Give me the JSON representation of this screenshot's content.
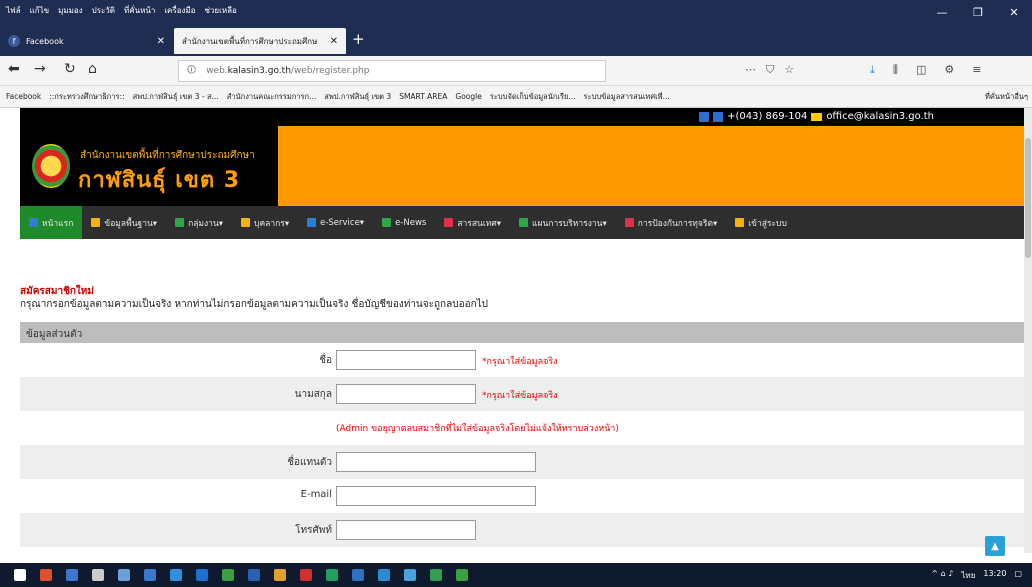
{
  "browser": {
    "menu": [
      "ไฟล์",
      "แก้ไข",
      "มุมมอง",
      "ประวัติ",
      "ที่คั่นหน้า",
      "เครื่องมือ",
      "ช่วยเหลือ"
    ],
    "tabs": [
      {
        "label": "Facebook",
        "active": false
      },
      {
        "label": "สำนักงานเขตพื้นที่การศึกษาประถมศึกษ",
        "active": true
      }
    ],
    "url_prefix": "web.",
    "url_host": "kalasin3.go.th",
    "url_path": "/web/register.php",
    "bookmarks": [
      "Facebook",
      "::กระทรวงศึกษาธิการ::",
      "สพป.กาฬสินธุ์ เขต 3 - ส...",
      "สำนักงานคณะกรรมการก...",
      "สพป.กาฬสินธุ์ เขต 3",
      "SMART AREA",
      "Google",
      "ระบบจัดเก็บข้อมูลนักเรีย...",
      "ระบบข้อมูลสารสนเทศเพื่..."
    ],
    "bookmarks_more": "ที่คั่นหน้าอื่นๆ"
  },
  "site": {
    "contact_phone": "+(043) 869-104",
    "contact_email": "office@kalasin3.go.th",
    "org_name": "สำนักงานเขตพื้นที่การศึกษาประถมศึกษา",
    "district": "กาฬสินธุ์ เขต 3",
    "nav": [
      {
        "label": "หน้าแรก",
        "color": "#2e7bd8",
        "active": true
      },
      {
        "label": "ข้อมูลพื้นฐาน▾",
        "color": "#f5b400"
      },
      {
        "label": "กลุ่มงาน▾",
        "color": "#2ea64a"
      },
      {
        "label": "บุคลากร▾",
        "color": "#f5b400"
      },
      {
        "label": "e-Service▾",
        "color": "#2e7bd8"
      },
      {
        "label": "e-News",
        "color": "#2ea64a"
      },
      {
        "label": "สารสนเทศ▾",
        "color": "#e0304a"
      },
      {
        "label": "แผนการบริหารงาน▾",
        "color": "#2ea64a"
      },
      {
        "label": "การป้องกันการทุจริต▾",
        "color": "#e0304a"
      },
      {
        "label": "เข้าสู่ระบบ",
        "color": "#f5b400"
      }
    ]
  },
  "form": {
    "title": "สมัครสมาชิกใหม่",
    "note": "กรุณากรอกข้อมูลตามความเป็นจริง หากท่านไม่กรอกข้อมูลตามความเป็นจริง ชื่อบัญชีของท่านจะถูกลบออกไป",
    "section": "ข้อมูลส่วนตัว",
    "first_name_label": "ชื่อ",
    "last_name_label": "นามสกุล",
    "required_hint": "*กรุณาใส่ข้อมูลจริง",
    "admin_warning": "(Admin ขอยุญาตลบสมาชิกที่ไม่ใส่ข้อมูลจริงโดยไม่แจ้งให้ทราบล่วงหน้า)",
    "nickname_label": "ชื่อแทนตัว",
    "email_label": "E-mail",
    "phone_label": "โทรศัพท์"
  },
  "taskbar": {
    "time": "13:20",
    "lang": "ไทย"
  }
}
